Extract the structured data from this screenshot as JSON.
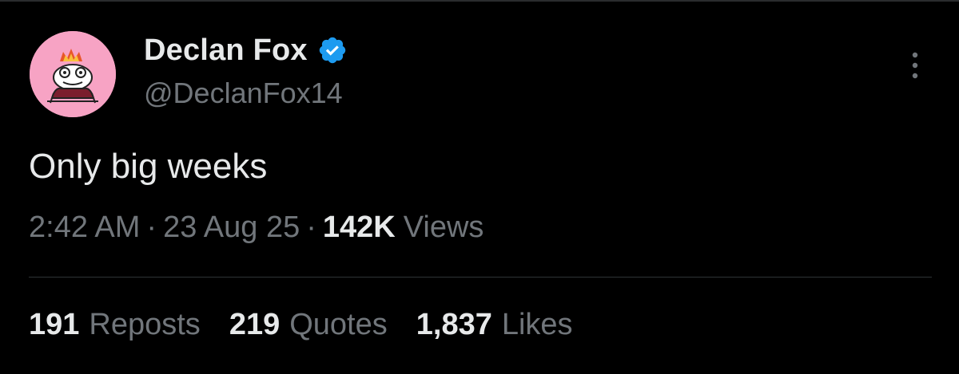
{
  "author": {
    "display_name": "Declan Fox",
    "handle": "@DeclanFox14",
    "verified": true,
    "verified_color": "#1d9bf0",
    "avatar_bg": "#f7a3c4"
  },
  "tweet": {
    "text": "Only big weeks",
    "time": "2:42 AM",
    "date": "23 Aug 25",
    "separator": "·",
    "views_count": "142K",
    "views_label": "Views"
  },
  "stats": [
    {
      "count": "191",
      "label": "Reposts"
    },
    {
      "count": "219",
      "label": "Quotes"
    },
    {
      "count": "1,837",
      "label": "Likes"
    }
  ],
  "icons": {
    "more": "more-vertical-icon",
    "verified": "verified-badge-icon"
  },
  "colors": {
    "background": "#000000",
    "primary_text": "#e7e9ea",
    "secondary_text": "#71767b",
    "divider": "#2f3336"
  }
}
